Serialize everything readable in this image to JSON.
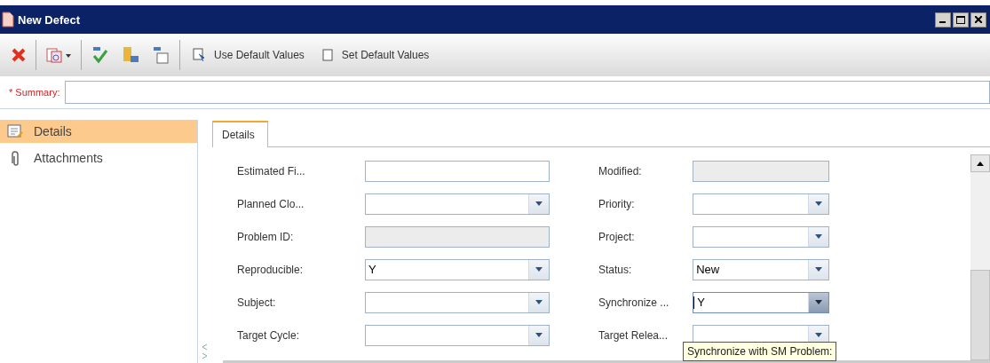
{
  "window": {
    "title": "New Defect"
  },
  "toolbar": {
    "buttons": [
      {
        "label": "Use Default Values"
      },
      {
        "label": "Set Default Values"
      }
    ]
  },
  "summary": {
    "label": "* Summary:",
    "required": true
  },
  "sidebar": {
    "items": [
      {
        "label": "Details",
        "selected": true
      },
      {
        "label": "Attachments",
        "selected": false
      }
    ]
  },
  "tabs": [
    {
      "label": "Details",
      "selected": true
    }
  ],
  "fields": [
    {
      "label": "Estimated Fi...",
      "kind": "text",
      "focused": false
    },
    {
      "label": "Modified:",
      "kind": "readonly",
      "focused": false
    },
    {
      "label": "Planned Clo...",
      "kind": "combo",
      "focused": false
    },
    {
      "label": "Priority:",
      "kind": "combo",
      "focused": false
    },
    {
      "label": "Problem ID:",
      "kind": "readonly",
      "focused": false
    },
    {
      "label": "Project:",
      "kind": "combo",
      "focused": false
    },
    {
      "label": "Reproducible:",
      "kind": "combo",
      "value": "Y",
      "focused": false
    },
    {
      "label": "Status:",
      "kind": "combo",
      "value": "New",
      "focused": false
    },
    {
      "label": "Subject:",
      "kind": "combo",
      "focused": false
    },
    {
      "label": "Synchronize ...",
      "kind": "combo",
      "value": "Y",
      "focused": true
    },
    {
      "label": "Target Cycle:",
      "kind": "combo",
      "focused": false
    },
    {
      "label": "Target Relea...",
      "kind": "combo",
      "focused": false
    }
  ],
  "tooltip": {
    "text": "Synchronize with SM Problem:"
  }
}
